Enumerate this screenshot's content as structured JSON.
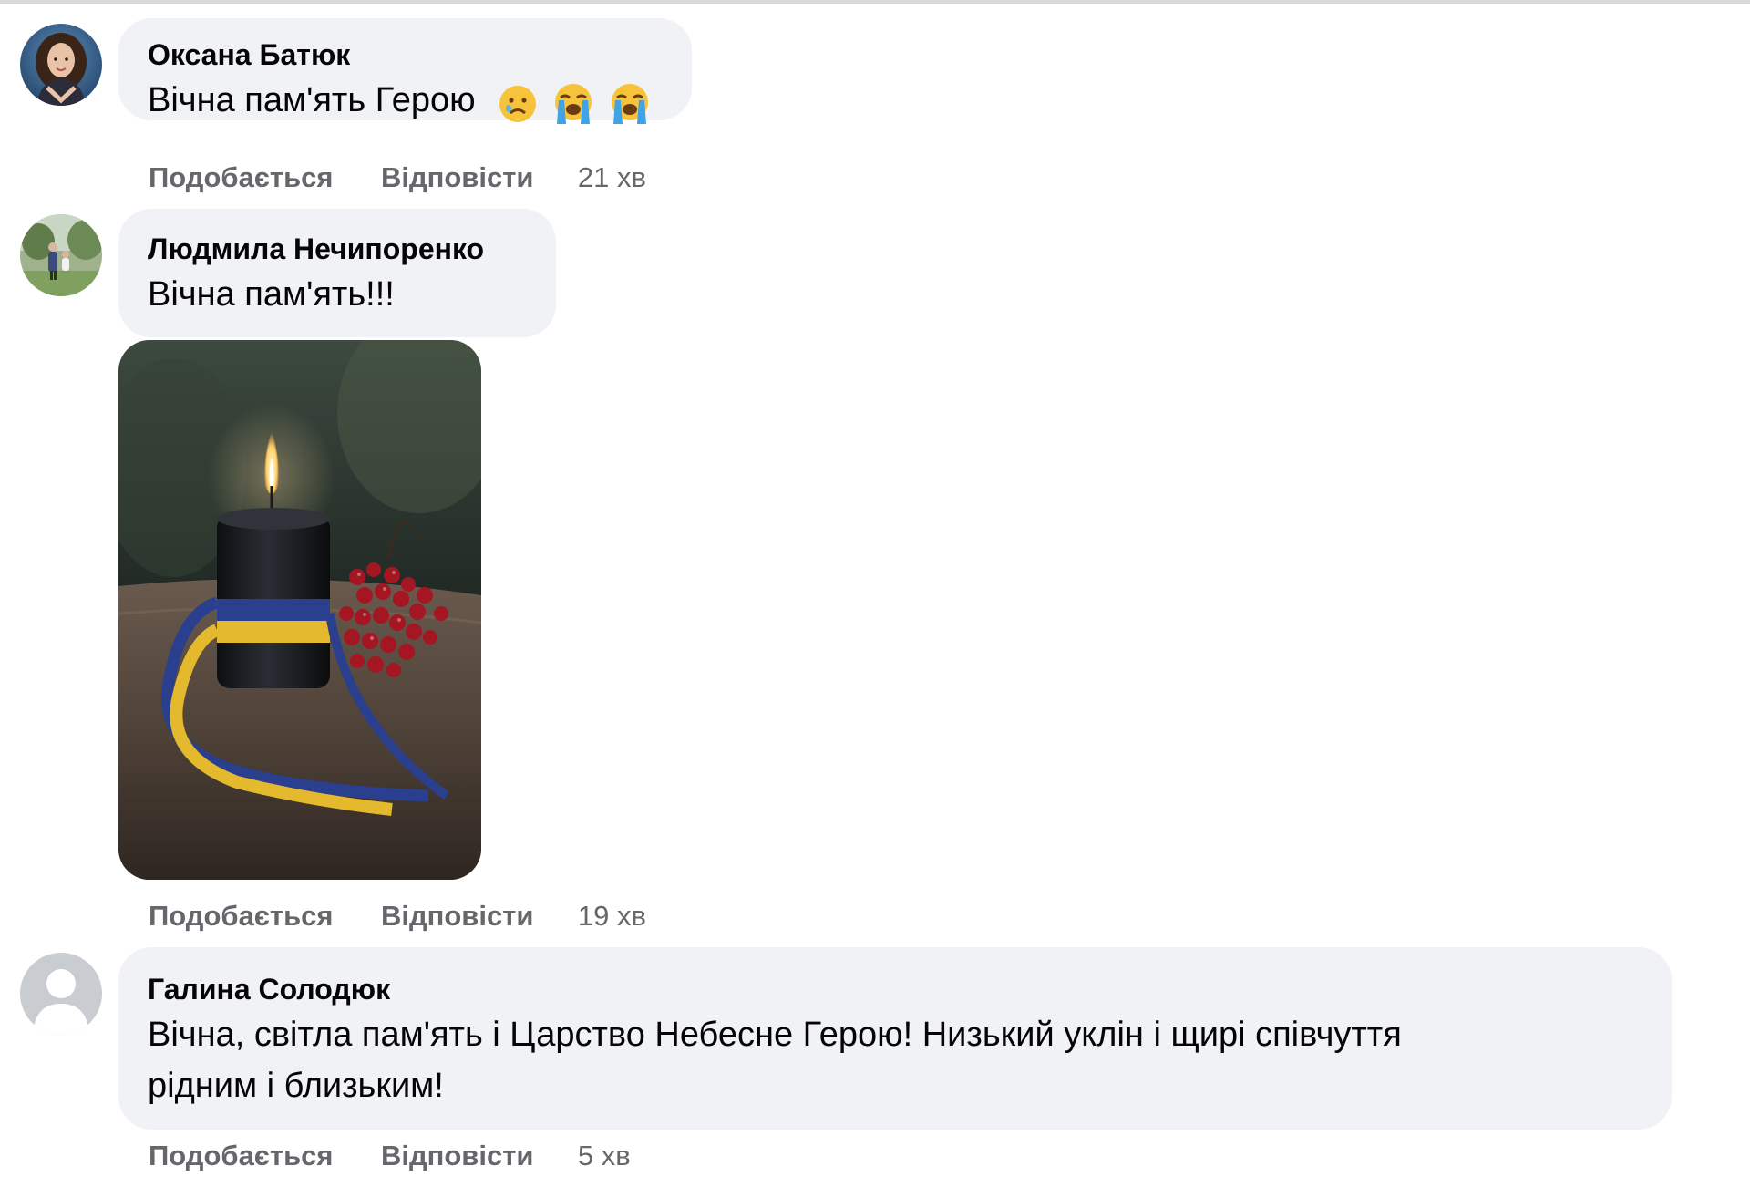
{
  "comments": [
    {
      "author": "Оксана Батюк",
      "text": "Вічна пам'ять Герою",
      "emojis": [
        "sad-face-emoji",
        "crying-face-emoji",
        "crying-face-emoji"
      ],
      "actions": {
        "like": "Подобається",
        "reply": "Відповісти"
      },
      "time": "21 хв"
    },
    {
      "author": "Людмила Нечипоренко",
      "text": "Вічна пам'ять!!!",
      "attachment": "candle-photo",
      "actions": {
        "like": "Подобається",
        "reply": "Відповісти"
      },
      "time": "19 хв"
    },
    {
      "author": "Галина Солодюк",
      "text_line1": "Вічна, світла пам'ять і Царство Небесне Герою! Низький уклін і щирі співчуття",
      "text_line2": "рідним і близьким!",
      "actions": {
        "like": "Подобається",
        "reply": "Відповісти"
      },
      "time": "5 хв"
    }
  ],
  "colors": {
    "bubble": "#f0f2f5",
    "secondary_text": "#65676b",
    "primary_text": "#050505"
  }
}
